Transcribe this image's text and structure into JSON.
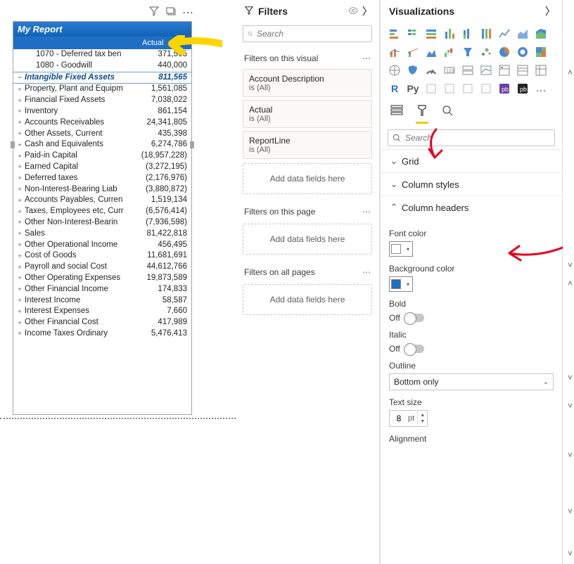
{
  "report": {
    "title": "My Report",
    "headerColumn": "Actual",
    "rows": [
      {
        "expander": "",
        "child": true,
        "label": "1070 - Deferred tax ben",
        "value": "371,565"
      },
      {
        "expander": "",
        "child": true,
        "label": "1080 - Goodwill",
        "value": "440,000"
      },
      {
        "expander": "−",
        "highlighted": true,
        "label": "Intangible Fixed Assets",
        "value": "811,565"
      },
      {
        "expander": "+",
        "label": "Property, Plant and Equipm",
        "value": "1,561,085"
      },
      {
        "expander": "+",
        "label": "Financial Fixed Assets",
        "value": "7,038,022"
      },
      {
        "expander": "+",
        "label": "Inventory",
        "value": "861,154"
      },
      {
        "expander": "+",
        "label": "Accounts Receivables",
        "value": "24,341,805"
      },
      {
        "expander": "+",
        "label": "Other Assets, Current",
        "value": "435,398"
      },
      {
        "expander": "+",
        "label": "Cash and Equivalents",
        "value": "6,274,786"
      },
      {
        "expander": "+",
        "label": "Paid-in Capital",
        "value": "(18,957,228)"
      },
      {
        "expander": "+",
        "label": "Earned Capital",
        "value": "(3,272,195)"
      },
      {
        "expander": "+",
        "label": "Deferred taxes",
        "value": "(2,176,976)"
      },
      {
        "expander": "+",
        "label": "Non-Interest-Bearing Liab",
        "value": "(3,880,872)"
      },
      {
        "expander": "+",
        "label": "Accounts Payables, Curren",
        "value": "1,519,134"
      },
      {
        "expander": "+",
        "label": "Taxes, Employees etc, Curr",
        "value": "(6,576,414)"
      },
      {
        "expander": "+",
        "label": "Other Non-Interest-Bearin",
        "value": "(7,936,598)"
      },
      {
        "expander": "+",
        "label": "Sales",
        "value": "81,422,818"
      },
      {
        "expander": "+",
        "label": "Other Operational Income",
        "value": "456,495"
      },
      {
        "expander": "+",
        "label": "Cost of Goods",
        "value": "11,681,691"
      },
      {
        "expander": "+",
        "label": "Payroll and social Cost",
        "value": "44,612,766"
      },
      {
        "expander": "+",
        "label": "Other Operating Expenses",
        "value": "19,873,589"
      },
      {
        "expander": "+",
        "label": "Other Financial Income",
        "value": "174,833"
      },
      {
        "expander": "+",
        "label": "Interest Income",
        "value": "58,587"
      },
      {
        "expander": "+",
        "label": "Interest Expenses",
        "value": "7,660"
      },
      {
        "expander": "+",
        "label": "Other Financial Cost",
        "value": "417,989"
      },
      {
        "expander": "+",
        "label": "Income Taxes Ordinary",
        "value": "5,476,413"
      }
    ]
  },
  "filters": {
    "paneTitle": "Filters",
    "searchPlaceholder": "Search",
    "visual": {
      "title": "Filters on this visual",
      "items": [
        {
          "name": "Account Description",
          "state": "is (All)"
        },
        {
          "name": "Actual",
          "state": "is (All)"
        },
        {
          "name": "ReportLine",
          "state": "is (All)"
        }
      ],
      "dropLabel": "Add data fields here"
    },
    "page": {
      "title": "Filters on this page",
      "dropLabel": "Add data fields here"
    },
    "all": {
      "title": "Filters on all pages",
      "dropLabel": "Add data fields here"
    }
  },
  "viz": {
    "paneTitle": "Visualizations",
    "searchPlaceholder": "Search",
    "icons": {
      "r": "R",
      "py": "Py",
      "ellipsis": "…"
    },
    "sections": {
      "grid": "Grid",
      "columnStyles": "Column styles",
      "columnHeaders": "Column headers"
    },
    "columnHeaders": {
      "fontColorLabel": "Font color",
      "fontColor": "#ffffff",
      "bgColorLabel": "Background color",
      "bgColor": "#1f6fc4",
      "boldLabel": "Bold",
      "boldState": "Off",
      "italicLabel": "Italic",
      "italicState": "Off",
      "outlineLabel": "Outline",
      "outlineValue": "Bottom only",
      "textSizeLabel": "Text size",
      "textSizeValue": "8",
      "textSizeUnit": "pt",
      "alignmentLabel": "Alignment"
    }
  }
}
